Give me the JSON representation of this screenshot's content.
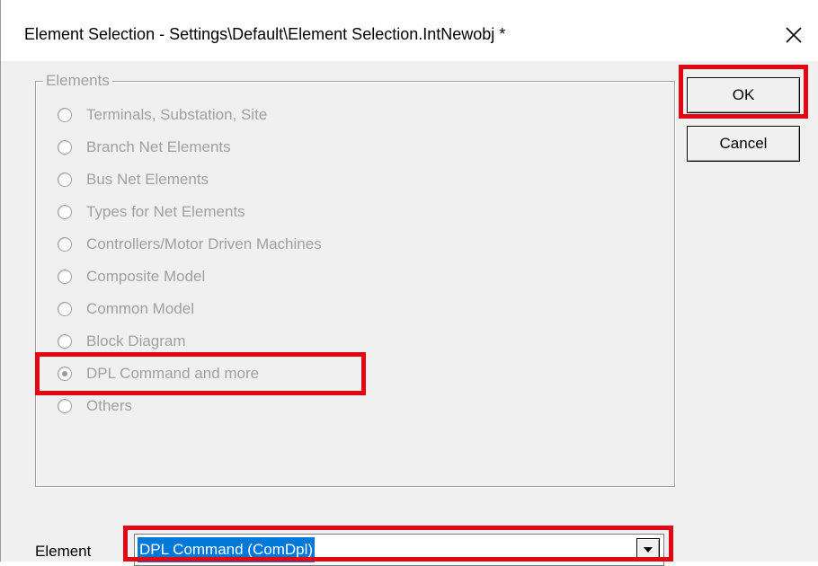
{
  "window": {
    "title": "Element Selection - Settings\\Default\\Element Selection.IntNewobj *",
    "close_glyph": "✕"
  },
  "group": {
    "legend": "Elements",
    "options": [
      {
        "label": "Terminals, Substation, Site",
        "selected": false
      },
      {
        "label": "Branch Net Elements",
        "selected": false
      },
      {
        "label": "Bus Net Elements",
        "selected": false
      },
      {
        "label": "Types for Net Elements",
        "selected": false
      },
      {
        "label": "Controllers/Motor Driven Machines",
        "selected": false
      },
      {
        "label": "Composite Model",
        "selected": false
      },
      {
        "label": "Common Model",
        "selected": false
      },
      {
        "label": "Block Diagram",
        "selected": false
      },
      {
        "label": "DPL Command and more",
        "selected": true
      },
      {
        "label": "Others",
        "selected": false
      }
    ]
  },
  "buttons": {
    "ok": "OK",
    "cancel": "Cancel"
  },
  "element": {
    "label": "Element",
    "value": "DPL Command (ComDpl)"
  },
  "colors": {
    "highlight": "#e30613",
    "selection": "#0078d7",
    "disabled_text": "#a0a0a0"
  },
  "icons": {
    "close": "close-icon",
    "dropdown": "dropdown-arrow-icon",
    "radio": "radio-button-icon"
  }
}
